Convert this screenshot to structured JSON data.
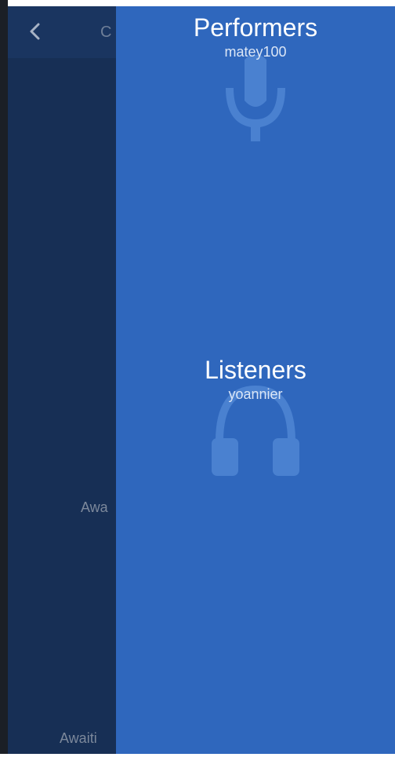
{
  "background": {
    "header_title": "C",
    "awaiting_1": "Awa",
    "awaiting_2": "Awaiti"
  },
  "drawer": {
    "performers": {
      "title": "Performers",
      "users": [
        "matey100"
      ]
    },
    "listeners": {
      "title": "Listeners",
      "users": [
        "yoannier"
      ]
    }
  },
  "icons": {
    "back": "chevron-left-icon",
    "performers": "microphone-icon",
    "listeners": "headphones-icon"
  },
  "colors": {
    "drawer_bg": "#2f67bd",
    "background_app": "#172f55",
    "icon_watermark": "#4a81d0"
  }
}
